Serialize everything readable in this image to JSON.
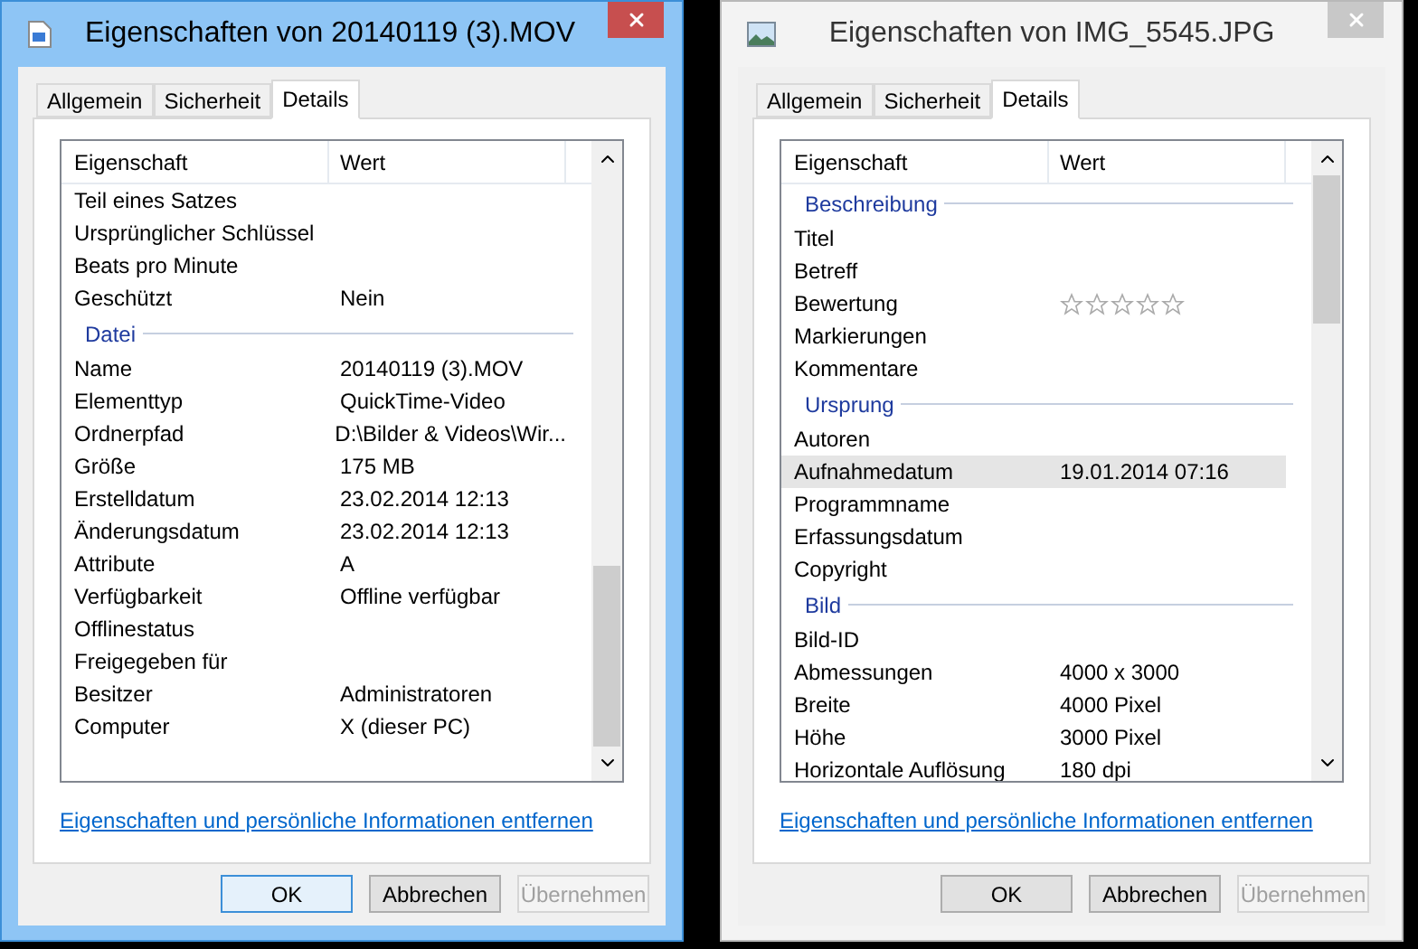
{
  "windows": [
    {
      "title": "Eigenschaften von 20140119 (3).MOV",
      "active": true,
      "tabs": [
        {
          "label": "Allgemein",
          "selected": false
        },
        {
          "label": "Sicherheit",
          "selected": false
        },
        {
          "label": "Details",
          "selected": true
        }
      ],
      "columns": [
        "Eigenschaft",
        "Wert"
      ],
      "rows": [
        {
          "kind": "property",
          "label": "Teil eines Satzes",
          "selected": false
        },
        {
          "kind": "property",
          "label": "Ursprünglicher Schlüssel",
          "selected": false
        },
        {
          "kind": "property",
          "label": "Beats pro Minute",
          "selected": false
        },
        {
          "kind": "property",
          "label": "Geschützt",
          "value": "Nein",
          "selected": false
        },
        {
          "kind": "group",
          "label": "Datei",
          "selected": false
        },
        {
          "kind": "property",
          "label": "Name",
          "value": "20140119 (3).MOV",
          "selected": false
        },
        {
          "kind": "property",
          "label": "Elementtyp",
          "value": "QuickTime-Video",
          "selected": false
        },
        {
          "kind": "property",
          "label": "Ordnerpfad",
          "value": "D:\\Bilder & Videos\\Wir...",
          "selected": false
        },
        {
          "kind": "property",
          "label": "Größe",
          "value": "175 MB",
          "selected": false
        },
        {
          "kind": "property",
          "label": "Erstelldatum",
          "value": "23.02.2014 12:13",
          "selected": false
        },
        {
          "kind": "property",
          "label": "Änderungsdatum",
          "value": "23.02.2014 12:13",
          "selected": false
        },
        {
          "kind": "property",
          "label": "Attribute",
          "value": "A",
          "selected": false
        },
        {
          "kind": "property",
          "label": "Verfügbarkeit",
          "value": "Offline verfügbar",
          "selected": false
        },
        {
          "kind": "property",
          "label": "Offlinestatus",
          "selected": false
        },
        {
          "kind": "property",
          "label": "Freigegeben für",
          "selected": false
        },
        {
          "kind": "property",
          "label": "Besitzer",
          "value": "Administratoren",
          "selected": false
        },
        {
          "kind": "property",
          "label": "Computer",
          "value": "X (dieser PC)",
          "selected": false
        }
      ],
      "link": "Eigenschaften und persönliche Informationen entfernen",
      "buttons": [
        {
          "label": "OK",
          "default": true,
          "disabled": false
        },
        {
          "label": "Abbrechen",
          "default": false,
          "disabled": false
        },
        {
          "label": "Übernehmen",
          "disabled": true
        }
      ]
    },
    {
      "title": "Eigenschaften von IMG_5545.JPG",
      "active": false,
      "tabs": [
        {
          "label": "Allgemein",
          "selected": false
        },
        {
          "label": "Sicherheit",
          "selected": false
        },
        {
          "label": "Details",
          "selected": true
        }
      ],
      "columns": [
        "Eigenschaft",
        "Wert"
      ],
      "rows": [
        {
          "kind": "group",
          "label": "Beschreibung",
          "selected": false
        },
        {
          "kind": "property",
          "label": "Titel",
          "selected": false
        },
        {
          "kind": "property",
          "label": "Betreff",
          "selected": false
        },
        {
          "kind": "rating",
          "label": "Bewertung",
          "stars": 0,
          "selected": false
        },
        {
          "kind": "property",
          "label": "Markierungen",
          "selected": false
        },
        {
          "kind": "property",
          "label": "Kommentare",
          "selected": false
        },
        {
          "kind": "group",
          "label": "Ursprung",
          "selected": false
        },
        {
          "kind": "property",
          "label": "Autoren",
          "selected": false
        },
        {
          "kind": "property",
          "label": "Aufnahmedatum",
          "value": "19.01.2014 07:16",
          "selected": true
        },
        {
          "kind": "property",
          "label": "Programmname",
          "selected": false
        },
        {
          "kind": "property",
          "label": "Erfassungsdatum",
          "selected": false
        },
        {
          "kind": "property",
          "label": "Copyright",
          "selected": false
        },
        {
          "kind": "group",
          "label": "Bild",
          "selected": false
        },
        {
          "kind": "property",
          "label": "Bild-ID",
          "selected": false
        },
        {
          "kind": "property",
          "label": "Abmessungen",
          "value": "4000 x 3000",
          "selected": false
        },
        {
          "kind": "property",
          "label": "Breite",
          "value": "4000 Pixel",
          "selected": false
        },
        {
          "kind": "property",
          "label": "Höhe",
          "value": "3000 Pixel",
          "selected": false
        },
        {
          "kind": "property",
          "label": "Horizontale Auflösung",
          "value": "180 dpi",
          "selected": false
        }
      ],
      "link": "Eigenschaften und persönliche Informationen entfernen",
      "buttons": [
        {
          "label": "OK",
          "disabled": false
        },
        {
          "label": "Abbrechen",
          "disabled": false
        },
        {
          "label": "Übernehmen",
          "disabled": true
        }
      ]
    }
  ]
}
